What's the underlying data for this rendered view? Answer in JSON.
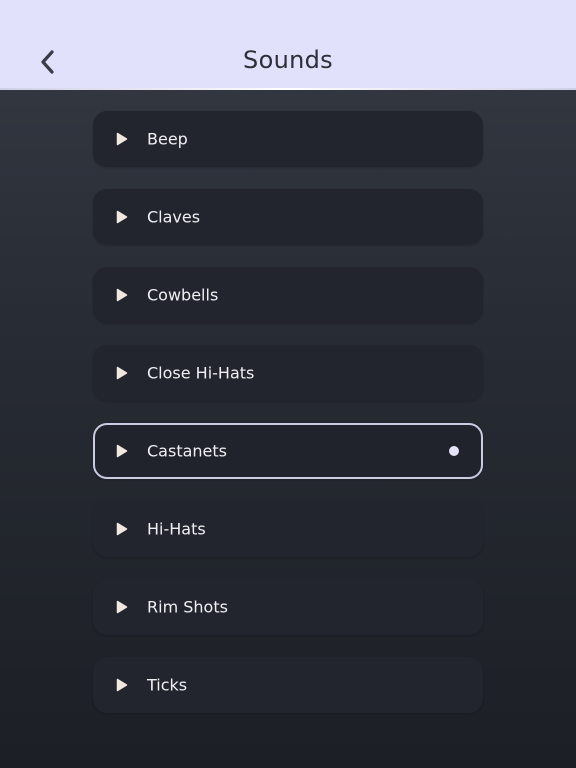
{
  "header": {
    "title": "Sounds",
    "back_icon": "chevron-left-icon"
  },
  "sounds": [
    {
      "label": "Beep",
      "selected": false
    },
    {
      "label": "Claves",
      "selected": false
    },
    {
      "label": "Cowbells",
      "selected": false
    },
    {
      "label": "Close Hi-Hats",
      "selected": false
    },
    {
      "label": "Castanets",
      "selected": true
    },
    {
      "label": "Hi-Hats",
      "selected": false
    },
    {
      "label": "Rim Shots",
      "selected": false
    },
    {
      "label": "Ticks",
      "selected": false
    }
  ],
  "colors": {
    "header_bg": "#e2e1fb",
    "item_bg": "#22252d",
    "selected_border": "#cbcbe2",
    "play_icon": "#f1e8df"
  }
}
